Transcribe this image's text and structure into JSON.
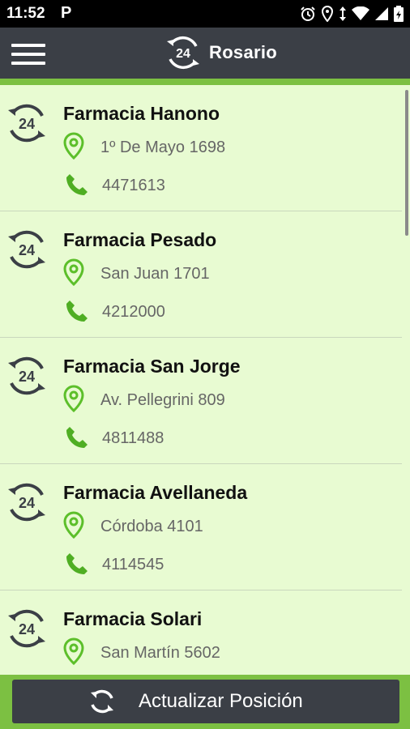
{
  "status_bar": {
    "time": "11:52",
    "badge": "P"
  },
  "app_bar": {
    "title": "Rosario",
    "logo_text": "24"
  },
  "pharmacies": [
    {
      "name": "Farmacia Hanono",
      "address": "1º De Mayo 1698",
      "phone": "4471613"
    },
    {
      "name": "Farmacia Pesado",
      "address": "San Juan 1701",
      "phone": "4212000"
    },
    {
      "name": "Farmacia San Jorge",
      "address": "Av. Pellegrini 809",
      "phone": "4811488"
    },
    {
      "name": "Farmacia Avellaneda",
      "address": "Córdoba 4101",
      "phone": "4114545"
    },
    {
      "name": "Farmacia Solari",
      "address": "San Martín 5602",
      "phone": ""
    }
  ],
  "footer": {
    "button_label": "Actualizar Posición"
  },
  "colors": {
    "accent_green": "#7cc042",
    "dark_bar": "#3b3f46",
    "list_bg": "#e8fbd2"
  }
}
